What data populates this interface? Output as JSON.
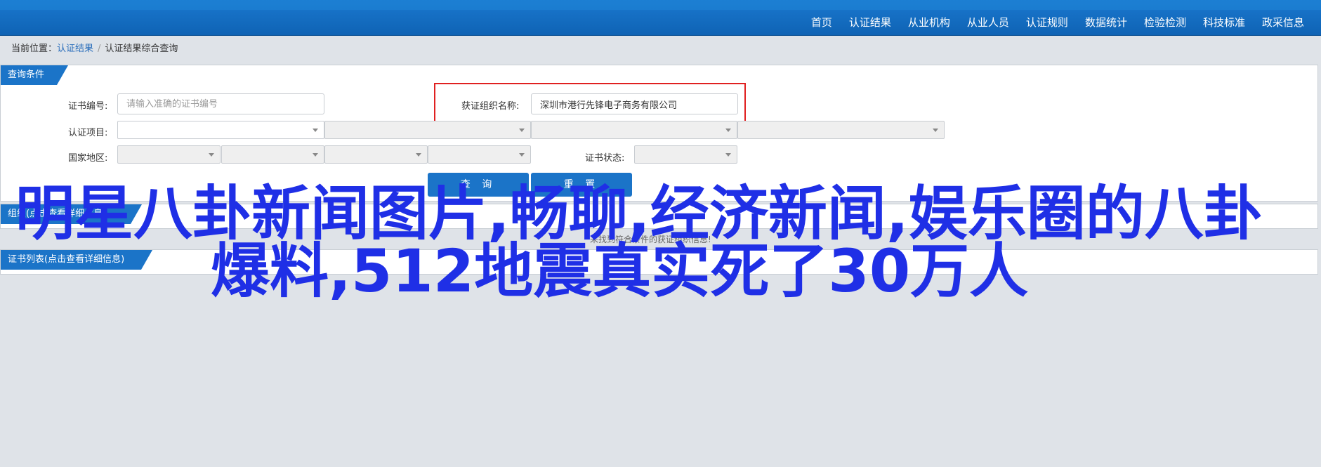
{
  "nav": {
    "items": [
      "首页",
      "认证结果",
      "从业机构",
      "从业人员",
      "认证规则",
      "数据统计",
      "检验检测",
      "科技标准",
      "政采信息"
    ]
  },
  "breadcrumb": {
    "prefix": "当前位置：",
    "link": "认证结果",
    "separator": "/",
    "current": "认证结果综合查询"
  },
  "query_panel": {
    "title": "查询条件",
    "cert_no_label": "证书编号:",
    "cert_no_placeholder": "请输入准确的证书编号",
    "org_name_label": "获证组织名称:",
    "org_name_value": "深圳市港行先锋电子商务有限公司",
    "project_label": "认证项目:",
    "region_label": "国家地区:",
    "status_label": "证书状态:",
    "search_button": "查 询",
    "reset_button": "重 置"
  },
  "org_panel": {
    "title": "组织(点击查看详细信息)",
    "empty_note": "未找到符合条件的获证组织信息!"
  },
  "cert_panel": {
    "title": "证书列表(点击查看详细信息)"
  },
  "overlay": {
    "line1": "明星八卦新闻图片,畅聊,经济新闻,娱乐圈的八卦",
    "line2": "爆料,512地震真实死了30万人"
  },
  "colors": {
    "nav_bg": "#1a78cf",
    "tab_bg": "#1b74c8",
    "highlight_border": "#e02020",
    "overlay_text": "#1f2fe6"
  }
}
